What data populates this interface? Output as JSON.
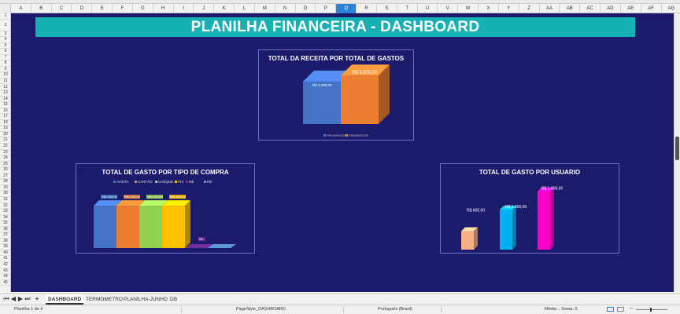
{
  "columns": [
    "A",
    "B",
    "C",
    "D",
    "E",
    "F",
    "G",
    "H",
    "I",
    "J",
    "K",
    "L",
    "M",
    "N",
    "O",
    "P",
    "Q",
    "R",
    "S",
    "T",
    "U",
    "V",
    "W",
    "X",
    "Y",
    "Z",
    "AA",
    "AB",
    "AC",
    "AD",
    "AE",
    "AF",
    "AG"
  ],
  "selected_column": "Q",
  "rows": [
    "1",
    "2",
    "3",
    "4",
    "5",
    "6",
    "7",
    "8",
    "9",
    "10",
    "11",
    "12",
    "13",
    "14",
    "15",
    "16",
    "17",
    "18",
    "19",
    "20",
    "21",
    "22",
    "23",
    "24",
    "25",
    "26",
    "27",
    "28",
    "29",
    "30",
    "31",
    "32",
    "33",
    "34",
    "35",
    "36",
    "37",
    "38",
    "39",
    "40",
    "41",
    "42",
    "43",
    "44",
    "45"
  ],
  "title": "PLANILHA FINANCEIRA - DASHBOARD",
  "colors": {
    "sheet_bg": "#1c1a6b",
    "title_bg": "#15b1b4",
    "selected_col": "#2a82d9"
  },
  "chart_data": [
    {
      "type": "bar",
      "title": "TOTAL DA RECEITA POR TOTAL DE GASTOS",
      "series": [
        {
          "name": "PROVENTOS",
          "values": [
            3480
          ],
          "label": "R$ 3.480,00",
          "color": "#4472c4"
        },
        {
          "name": "PROVENTOS",
          "values": [
            3970
          ],
          "label": "R$ 3.970,00",
          "color": "#ed7d31"
        }
      ],
      "ylim": [
        0,
        4500
      ],
      "legend": "bottom"
    },
    {
      "type": "bar",
      "title": "TOTAL DE GASTO POR TIPO DE COMPRA",
      "series": [
        {
          "name": "AVISTA",
          "values": [
            1000
          ],
          "label": "R$1.000,00",
          "color": "#4472c4"
        },
        {
          "name": "CARTÃO",
          "values": [
            1000
          ],
          "label": "R$1.000,00",
          "color": "#ed7d31"
        },
        {
          "name": "CHEQUE",
          "values": [
            1000
          ],
          "label": "R$1.000,00",
          "color": "#92d050"
        },
        {
          "name": "PIX",
          "values": [
            1000
          ],
          "label": "R$1.000,00",
          "color": "#ffc000"
        },
        {
          "name": "R$ -",
          "values": [
            0
          ],
          "label": "R$ -",
          "color": "#7030a0"
        },
        {
          "name": "R$ -",
          "values": [
            0
          ],
          "label": "",
          "color": "#5b9bd5"
        }
      ],
      "ylim": [
        0,
        1300
      ],
      "legend": "top"
    },
    {
      "type": "bar",
      "title": "TOTAL DE GASTO POR USUARIO",
      "categories": [
        "",
        "",
        ""
      ],
      "values": [
        600,
        1300,
        1900
      ],
      "labels": [
        "R$ 600,00",
        "R$ 1.300,00",
        "R$ 1.900,00"
      ],
      "colors": [
        "#f4b183",
        "#00b0f0",
        "#ff00cc"
      ],
      "ylim": [
        0,
        2200
      ]
    }
  ],
  "tabs": [
    "DASHBOARD",
    "TERMOMETRO",
    "PLANILHA-JUNHO",
    "DB"
  ],
  "add_tab_label": "+",
  "status": {
    "sheet": "Planilha 1 de 4",
    "pagestyle": "PageStyle_DASHBOARD",
    "language": "Português (Brasil)",
    "summary": "Média: ; Soma: 0"
  }
}
